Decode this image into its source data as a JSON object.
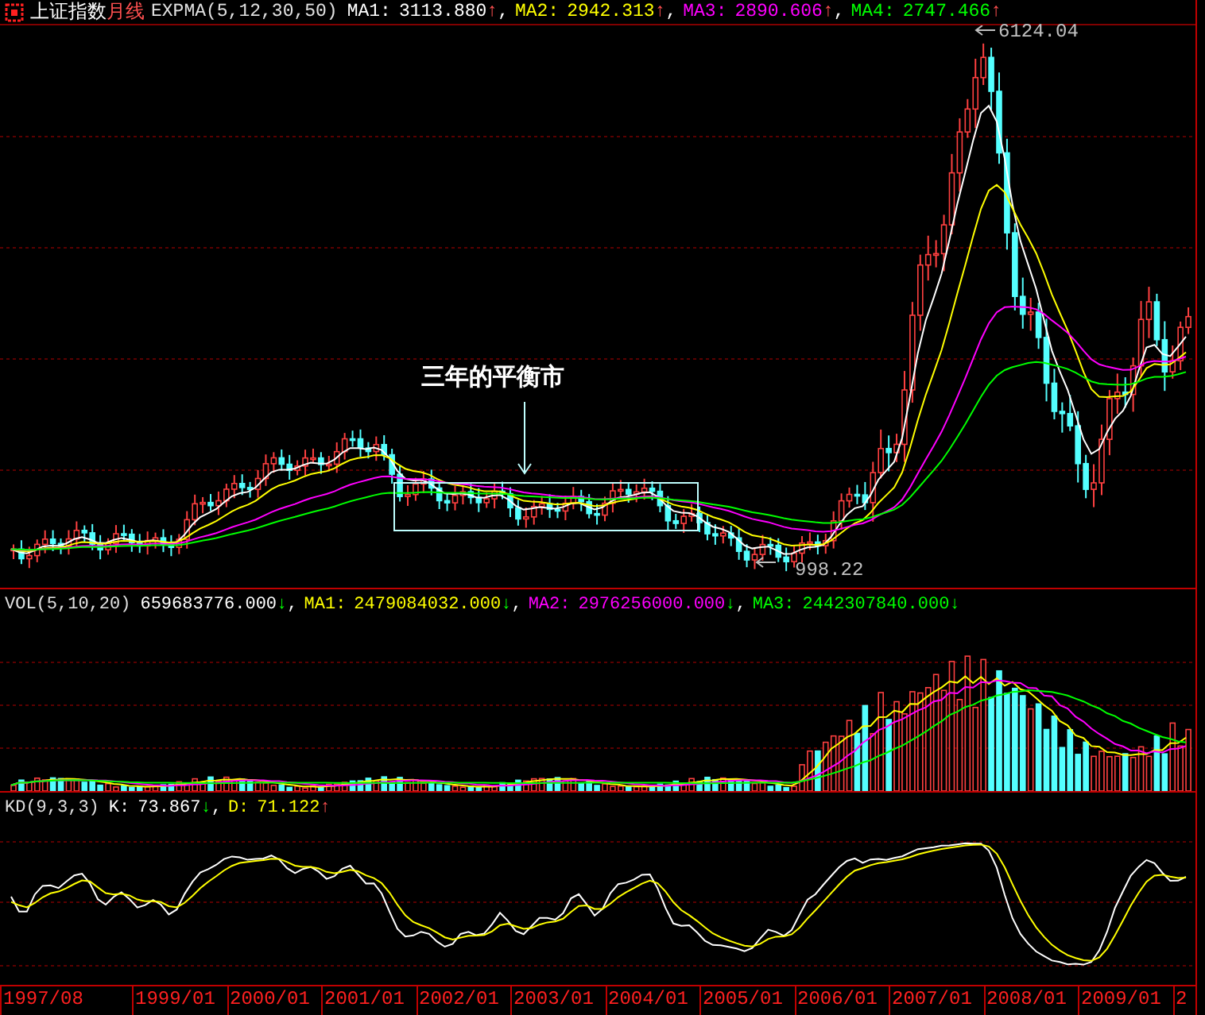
{
  "header": {
    "market": "上证指数",
    "period": "月线",
    "indicator": "EXPMA(5,12,30,50)",
    "values": [
      {
        "label": "MA1:",
        "value": "3113.880",
        "arrow": "↑",
        "rising": true,
        "color": "#ffffff",
        "sep": ","
      },
      {
        "label": "MA2:",
        "value": "2942.313",
        "arrow": "↑",
        "rising": true,
        "color": "#ffff00",
        "sep": ","
      },
      {
        "label": "MA3:",
        "value": "2890.606",
        "arrow": "↑",
        "rising": true,
        "color": "#ff00ff",
        "sep": ","
      },
      {
        "label": "MA4:",
        "value": "2747.466",
        "arrow": "↑",
        "rising": true,
        "color": "#00ff00"
      }
    ]
  },
  "main_chart": {
    "annotations": [
      {
        "kind": "high",
        "text": "6124.04"
      },
      {
        "kind": "low",
        "text": "998.22"
      },
      {
        "kind": "callout",
        "text": "三年的平衡市"
      }
    ]
  },
  "volume": {
    "indicator": "VOL(5,10,20)",
    "values": [
      {
        "value": "659683776.000",
        "arrow": "↓",
        "rising": false,
        "color": "#ffffff",
        "sep": ","
      },
      {
        "label": "MA1:",
        "value": "2479084032.000",
        "arrow": "↓",
        "rising": false,
        "color": "#ffff00",
        "sep": ","
      },
      {
        "label": "MA2:",
        "value": "2976256000.000",
        "arrow": "↓",
        "rising": false,
        "color": "#ff00ff",
        "sep": ","
      },
      {
        "label": "MA3:",
        "value": "2442307840.000",
        "arrow": "↓",
        "rising": false,
        "color": "#00ff00"
      }
    ]
  },
  "kd": {
    "indicator": "KD(9,3,3)",
    "values": [
      {
        "label": "K:",
        "value": "73.867",
        "arrow": "↓",
        "rising": false,
        "color": "#ffffff",
        "sep": ","
      },
      {
        "label": "D:",
        "value": "71.122",
        "arrow": "↑",
        "rising": true,
        "color": "#ffff00"
      }
    ]
  },
  "x_axis": {
    "labels": [
      "1997/08",
      "1999/01",
      "2000/01",
      "2001/01",
      "2002/01",
      "2003/01",
      "2004/01",
      "2005/01",
      "2006/01",
      "2007/01",
      "2008/01",
      "2009/01",
      "2"
    ]
  }
}
